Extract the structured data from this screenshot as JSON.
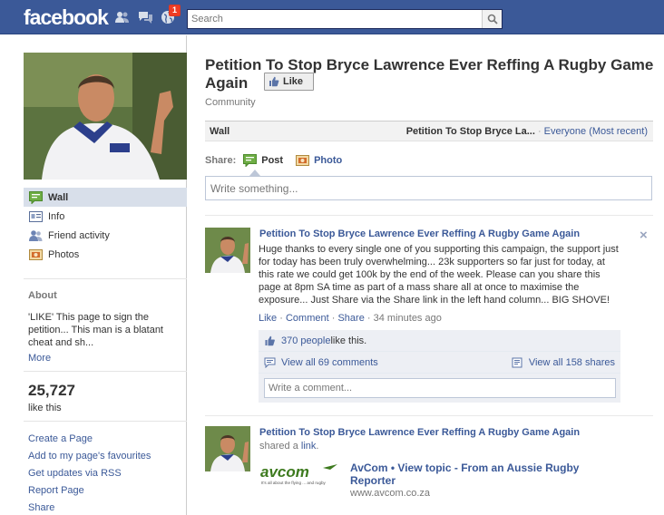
{
  "header": {
    "logo": "facebook",
    "notification_count": "1",
    "search_placeholder": "Search"
  },
  "sidebar": {
    "nav": [
      {
        "label": "Wall",
        "icon": "wall-icon"
      },
      {
        "label": "Info",
        "icon": "info-icon"
      },
      {
        "label": "Friend activity",
        "icon": "friends-icon"
      },
      {
        "label": "Photos",
        "icon": "photos-icon"
      }
    ],
    "about_heading": "About",
    "about_text": "'LIKE' This page to sign the petition... This man is a blatant cheat and sh...",
    "about_more": "More",
    "likes_count": "25,727",
    "likes_label": "like this",
    "links": [
      "Create a Page",
      "Add to my page's favourites",
      "Get updates via RSS",
      "Report Page",
      "Share"
    ]
  },
  "page": {
    "title": "Petition To Stop Bryce Lawrence Ever Reffing A Rugby Game Again",
    "like_button": "Like",
    "category": "Community",
    "wall_label": "Wall",
    "wall_filter_name": "Petition To Stop Bryce La...",
    "wall_filter_sep": " · ",
    "wall_filter_option": "Everyone (Most recent)",
    "share_label": "Share:",
    "share_post": "Post",
    "share_photo": "Photo",
    "composer_placeholder": "Write something..."
  },
  "posts": [
    {
      "author": "Petition To Stop Bryce Lawrence Ever Reffing A Rugby Game Again",
      "body": "Huge thanks to every single one of you supporting this campaign, the support just for today has been truly overwhelming... 23k supporters so far just for today, at this rate we could get 100k by the end of the week. Please can you share this page at 8pm SA time as part of a mass share all at once to maximise the exposure... Just Share via the Share link in the left hand column... BIG SHOVE!",
      "actions": {
        "like": "Like",
        "comment": "Comment",
        "share": "Share",
        "time": "34 minutes ago"
      },
      "likes_text_link": "370 people",
      "likes_text_rest": " like this.",
      "view_comments": "View all 69 comments",
      "view_shares": "View all 158 shares",
      "comment_placeholder": "Write a comment...",
      "close": "×"
    },
    {
      "author": "Petition To Stop Bryce Lawrence Ever Reffing A Rugby Game Again",
      "shared_prefix": "shared a ",
      "shared_link": "link",
      "shared_suffix": ".",
      "attachment": {
        "logo_text": "avcom",
        "logo_tagline": "It's all about the flying ... and rugby",
        "title": "AvCom • View topic - From an Aussie Rugby Reporter",
        "url": "www.avcom.co.za"
      }
    }
  ],
  "colors": {
    "brand_blue": "#3b5998",
    "nav_active": "#d8dfea",
    "badge_red": "#f03d25"
  }
}
